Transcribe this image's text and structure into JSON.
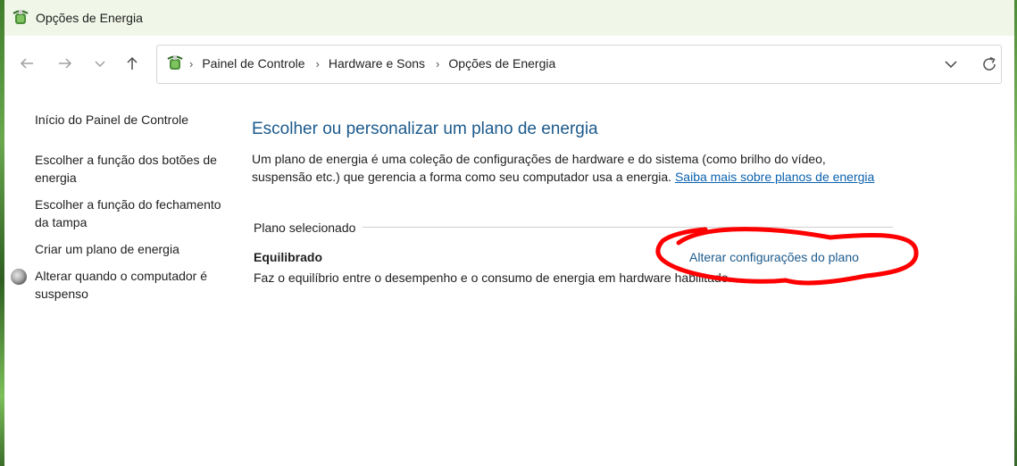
{
  "window": {
    "title": "Opções de Energia",
    "icon": "power-options-icon"
  },
  "navigation": {
    "back_icon": "back-arrow-icon",
    "forward_icon": "forward-arrow-icon",
    "recent_icon": "chevron-down-icon",
    "up_icon": "up-arrow-icon"
  },
  "address_bar": {
    "breadcrumbs": [
      "Painel de Controle",
      "Hardware e Sons",
      "Opções de Energia"
    ],
    "separator": "›"
  },
  "sidebar": {
    "items": [
      {
        "label": "Início do Painel de Controle"
      },
      {
        "label": "Escolher a função dos botões de energia"
      },
      {
        "label": "Escolher a função do fechamento da tampa"
      },
      {
        "label": "Criar um plano de energia"
      },
      {
        "label": "Alterar quando o computador é suspenso",
        "icon": "sleep-moon-icon"
      }
    ]
  },
  "main": {
    "heading": "Escolher ou personalizar um plano de energia",
    "intro_text": "Um plano de energia é uma coleção de configurações de hardware e do sistema (como brilho do vídeo, suspensão etc.) que gerencia a forma como seu computador usa a energia. ",
    "learn_more_link": "Saiba mais sobre planos de energia",
    "section_label": "Plano selecionado",
    "plan": {
      "name": "Equilibrado",
      "description": "Faz o equilíbrio entre o desempenho e o consumo de energia em hardware habilitado.",
      "change_link": "Alterar configurações do plano"
    }
  },
  "colors": {
    "heading": "#1c5a8c",
    "link": "#0b62ad",
    "annotation": "#ff0000"
  }
}
